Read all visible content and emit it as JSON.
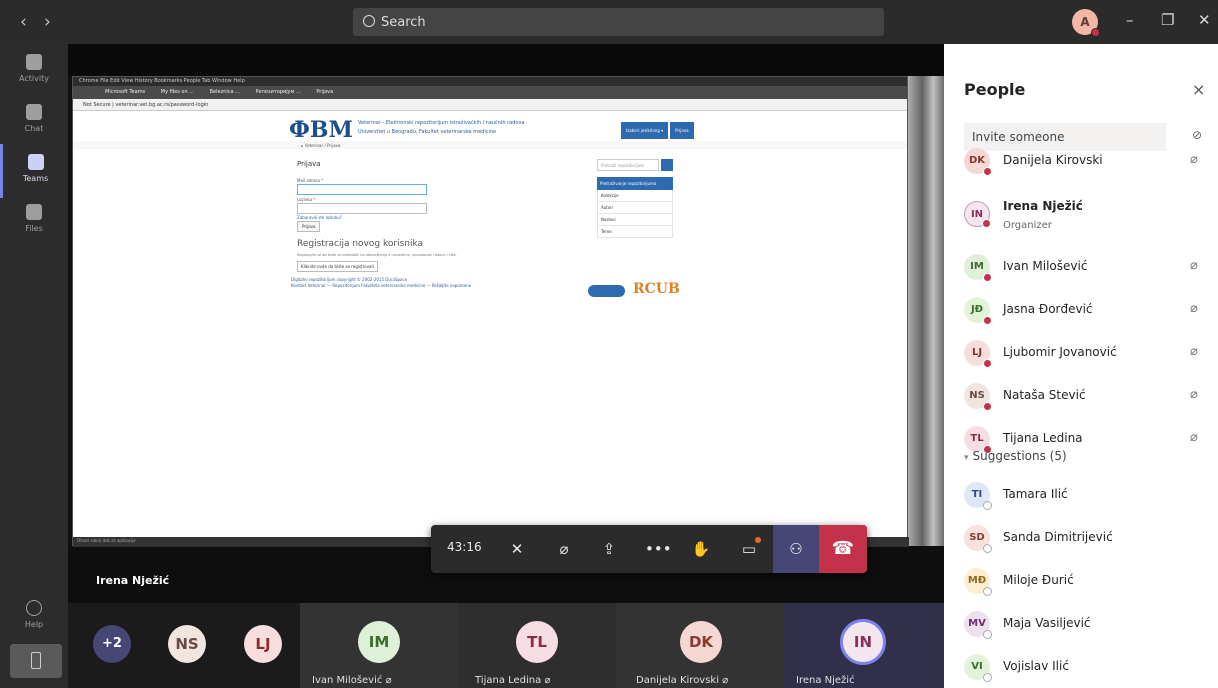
{
  "titlebar": {
    "back": "‹",
    "forward": "›",
    "search_placeholder": "Search",
    "account_initial": "A",
    "minimize": "–",
    "maximize": "❐",
    "close": "✕"
  },
  "rail": {
    "items": [
      {
        "label": "Activity",
        "icon": "bell-icon"
      },
      {
        "label": "Chat",
        "icon": "chat-icon"
      },
      {
        "label": "Teams",
        "icon": "teams-icon",
        "active": true
      },
      {
        "label": "Files",
        "icon": "files-icon"
      },
      {
        "label": "Help",
        "icon": "help-icon"
      }
    ]
  },
  "shared_screen": {
    "mac_menu": "Chrome   File   Edit   View   History   Bookmarks   People   Tab   Window   Help",
    "tabs": [
      "Microsoft Teams",
      "My files on ...",
      "Beleznica ...",
      "Репозиторијум ...",
      "Prijava"
    ],
    "url": "Not Secure | veterinar.vet.bg.ac.rs/password-login",
    "logo": "ФВМ",
    "site_title_line1": "Veterinar - Elektronski repozitorijum istraživačkih i naučnih radova",
    "site_title_line2": "Univerzitet u Beogradu, Fakultet veterinarske medicine",
    "site_btn1": "Izaberi jezik/lang ▾",
    "site_btn2": "Prijava",
    "breadcrumb": "⌂ Veterinar  /  Prijava",
    "login_title": "Prijava",
    "email_label": "Mail adresa *",
    "password_label": "Lozinka *",
    "forgot_link": "Zaboravili ste lozinku?",
    "login_btn": "Prijava",
    "register_title": "Registracija novog korisnika",
    "register_text": "Registrujte se da biste se pretplatili na obaveštenja o novostima, uploadovali radove i više.",
    "register_btn": "Kliknite ovde da biste se registrovali",
    "footer_line1": "Digitalni repozitorijum copyright © 2002-2015  DuraSpace",
    "footer_line2": "Kontakt Veterinar — Repozitorijum Fakulteta veterinarske medicine — Pošaljite napomenu",
    "sidebar_search": "Pretraži repozitorijum",
    "sidebar_header": "Pretraživanje repozitorijuma",
    "sidebar_items": [
      "Kolekcije",
      "Autori",
      "Naslovi",
      "Teme"
    ],
    "rcub": "RCUB",
    "dock_tip": "Otvori sakrij dok za aplikacije"
  },
  "controls": {
    "timer": "43:16",
    "camera_icon": "camera-off-icon",
    "mic_icon": "mic-off-icon",
    "share_icon": "share-screen-icon",
    "more": "•••",
    "raise_hand_icon": "raise-hand-icon",
    "chat_icon": "meeting-chat-icon",
    "people_icon": "people-icon",
    "hangup_icon": "hang-up-icon"
  },
  "presenter": "Irena Nježić",
  "gallery": {
    "overflow": "+2",
    "circles": [
      {
        "initials": "NS"
      },
      {
        "initials": "LJ"
      }
    ],
    "tiles": [
      {
        "initials": "IM",
        "name": "Ivan Milošević",
        "muted": true
      },
      {
        "initials": "TL",
        "name": "Tijana Ledina",
        "muted": true
      },
      {
        "initials": "DK",
        "name": "Danijela Kirovski",
        "muted": true
      },
      {
        "initials": "IN",
        "name": "Irena Nježić",
        "muted": false
      }
    ]
  },
  "panel": {
    "title": "People",
    "close": "×",
    "invite_placeholder": "Invite someone",
    "participants": [
      {
        "initials": "DK",
        "name": "Danijela Kirovski",
        "muted": true,
        "bg": "#f5d8d3",
        "fg": "#8a3a2e"
      },
      {
        "initials": "IN",
        "name": "Irena Nježić",
        "role": "Organizer",
        "bold": true,
        "bg": "#f3e6ee",
        "fg": "#8a2e5c"
      },
      {
        "initials": "IM",
        "name": "Ivan Milošević",
        "muted": true,
        "bg": "#dff0d8",
        "fg": "#3b6e2a"
      },
      {
        "initials": "JĐ",
        "name": "Jasna Đorđević",
        "muted": true,
        "bg": "#e3f3d9",
        "fg": "#3b6e2a"
      },
      {
        "initials": "LJ",
        "name": "Ljubomir Jovanović",
        "muted": true,
        "bg": "#f6dede",
        "fg": "#8a2e2e"
      },
      {
        "initials": "NS",
        "name": "Nataša Stević",
        "muted": true,
        "bg": "#f2e5e0",
        "fg": "#6b4a3f"
      },
      {
        "initials": "TL",
        "name": "Tijana Ledina",
        "muted": true,
        "bg": "#f6dde3",
        "fg": "#8a2e45"
      }
    ],
    "suggestions_label": "Suggestions (5)",
    "suggestions": [
      {
        "initials": "TI",
        "name": "Tamara Ilić",
        "bg": "#dfe7f6",
        "fg": "#2e4a8a"
      },
      {
        "initials": "SD",
        "name": "Sanda Dimitrijević",
        "bg": "#f6e2dc",
        "fg": "#8a3a2e"
      },
      {
        "initials": "MĐ",
        "name": "Miloje Đurić",
        "bg": "#fbefd0",
        "fg": "#8a6a1e"
      },
      {
        "initials": "MV",
        "name": "Maja Vasiljević",
        "bg": "#efe0ee",
        "fg": "#6e2e6a"
      },
      {
        "initials": "VI",
        "name": "Vojislav Ilić",
        "bg": "#e3f3d9",
        "fg": "#3b6e2a"
      }
    ]
  },
  "colors": {
    "accent": "#464775",
    "hangup": "#c4314b",
    "busy_status": "#c4314b"
  }
}
